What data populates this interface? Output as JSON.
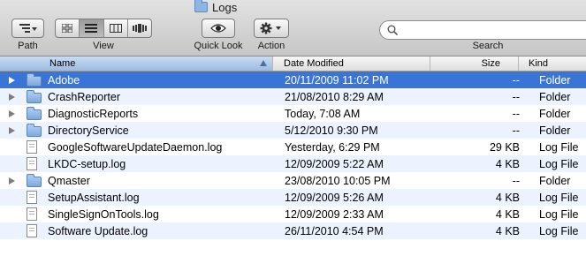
{
  "window": {
    "title": "Logs"
  },
  "toolbar": {
    "path_label": "Path",
    "view_label": "View",
    "quicklook_label": "Quick Look",
    "action_label": "Action",
    "search_label": "Search",
    "search_placeholder": ""
  },
  "columns": {
    "name": "Name",
    "date": "Date Modified",
    "size": "Size",
    "kind": "Kind"
  },
  "files": [
    {
      "name": "Adobe",
      "date": "20/11/2009 11:02 PM",
      "size": "--",
      "kind": "Folder",
      "type": "folder",
      "expandable": true,
      "selected": true
    },
    {
      "name": "CrashReporter",
      "date": "21/08/2010 8:29 AM",
      "size": "--",
      "kind": "Folder",
      "type": "folder",
      "expandable": true,
      "selected": false
    },
    {
      "name": "DiagnosticReports",
      "date": "Today, 7:08 AM",
      "size": "--",
      "kind": "Folder",
      "type": "folder",
      "expandable": true,
      "selected": false
    },
    {
      "name": "DirectoryService",
      "date": "5/12/2010 9:30 PM",
      "size": "--",
      "kind": "Folder",
      "type": "folder",
      "expandable": true,
      "selected": false
    },
    {
      "name": "GoogleSoftwareUpdateDaemon.log",
      "date": "Yesterday, 6:29 PM",
      "size": "29 KB",
      "kind": "Log File",
      "type": "file",
      "expandable": false,
      "selected": false
    },
    {
      "name": "LKDC-setup.log",
      "date": "12/09/2009 5:22 AM",
      "size": "4 KB",
      "kind": "Log File",
      "type": "file",
      "expandable": false,
      "selected": false
    },
    {
      "name": "Qmaster",
      "date": "23/08/2010 10:05 PM",
      "size": "--",
      "kind": "Folder",
      "type": "folder",
      "expandable": true,
      "selected": false
    },
    {
      "name": "SetupAssistant.log",
      "date": "12/09/2009 5:26 AM",
      "size": "4 KB",
      "kind": "Log File",
      "type": "file",
      "expandable": false,
      "selected": false
    },
    {
      "name": "SingleSignOnTools.log",
      "date": "12/09/2009 2:33 AM",
      "size": "4 KB",
      "kind": "Log File",
      "type": "file",
      "expandable": false,
      "selected": false
    },
    {
      "name": "Software Update.log",
      "date": "26/11/2010 4:54 PM",
      "size": "4 KB",
      "kind": "Log File",
      "type": "file",
      "expandable": false,
      "selected": false
    }
  ],
  "colors": {
    "selection": "#3875d7",
    "alt_row": "#edf3fe"
  }
}
